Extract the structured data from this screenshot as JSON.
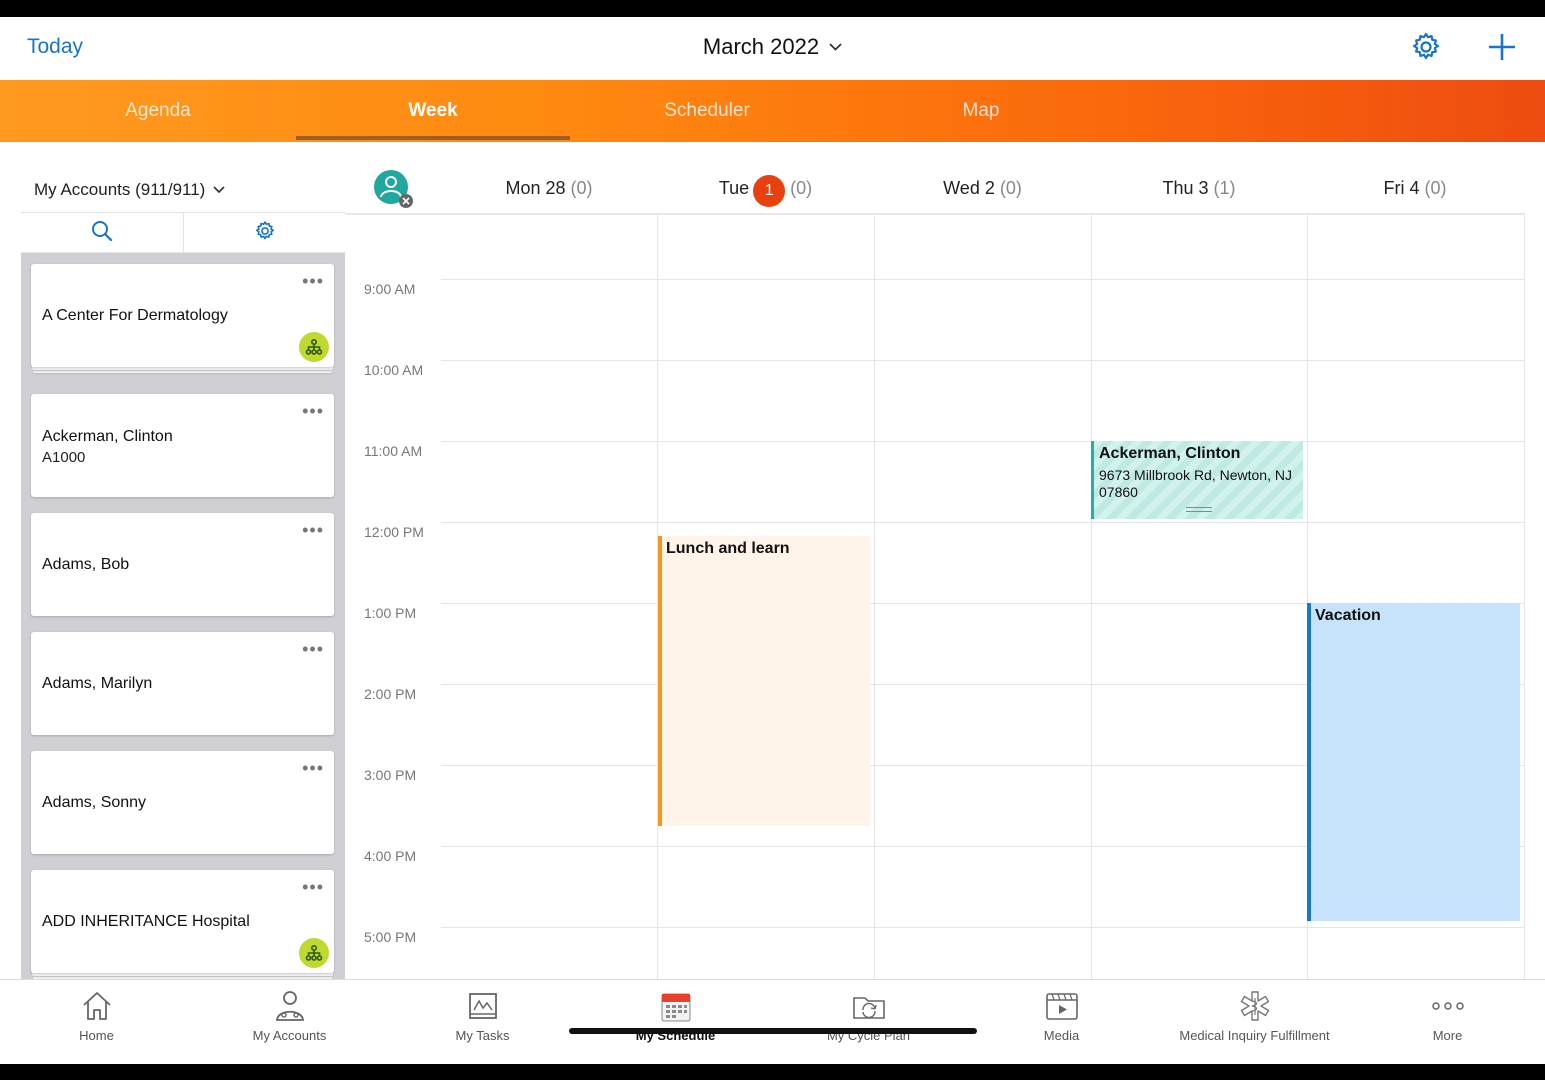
{
  "topbar": {
    "today_label": "Today",
    "month_title": "March 2022"
  },
  "tabs": [
    {
      "label": "Agenda",
      "active": false
    },
    {
      "label": "Week",
      "active": true
    },
    {
      "label": "Scheduler",
      "active": false
    },
    {
      "label": "Map",
      "active": false
    }
  ],
  "accounts": {
    "title": "My Accounts (911/911)",
    "items": [
      {
        "name": "A Center For Dermatology",
        "sub": "",
        "badge": true
      },
      {
        "name": "Ackerman, Clinton",
        "sub": "A1000",
        "badge": false
      },
      {
        "name": "Adams, Bob",
        "sub": "",
        "badge": false
      },
      {
        "name": "Adams, Marilyn",
        "sub": "",
        "badge": false
      },
      {
        "name": "Adams, Sonny",
        "sub": "",
        "badge": false
      },
      {
        "name": "ADD INHERITANCE Hospital",
        "sub": "",
        "badge": true
      }
    ]
  },
  "calendar": {
    "days": [
      {
        "label": "Mon 28",
        "count": "(0)"
      },
      {
        "label": "Tue",
        "today_num": "1",
        "count": "(0)"
      },
      {
        "label": "Wed 2",
        "count": "(0)"
      },
      {
        "label": "Thu 3",
        "count": "(1)"
      },
      {
        "label": "Fri 4",
        "count": "(0)"
      }
    ],
    "times": [
      "9:00 AM",
      "10:00 AM",
      "11:00 AM",
      "12:00 PM",
      "1:00 PM",
      "2:00 PM",
      "3:00 PM",
      "4:00 PM",
      "5:00 PM"
    ],
    "events": [
      {
        "title": "Ackerman, Clinton",
        "sub": "9673 Millbrook Rd, Newton, NJ 07860"
      },
      {
        "title": "Lunch and learn",
        "sub": ""
      },
      {
        "title": "Vacation",
        "sub": ""
      }
    ]
  },
  "bottom_nav": [
    {
      "label": "Home",
      "icon": "home-icon"
    },
    {
      "label": "My Accounts",
      "icon": "accounts-icon"
    },
    {
      "label": "My Tasks",
      "icon": "tasks-icon"
    },
    {
      "label": "My Schedule",
      "icon": "calendar-icon",
      "active": true
    },
    {
      "label": "My Cycle Plan",
      "icon": "cycle-plan-icon"
    },
    {
      "label": "Media",
      "icon": "media-icon"
    },
    {
      "label": "Medical Inquiry Fulfillment",
      "icon": "medical-icon"
    },
    {
      "label": "More",
      "icon": "more-icon"
    }
  ],
  "colors": {
    "accent_blue": "#1a73c9",
    "orange_start": "#ff9a1f",
    "orange_end": "#ee4c10",
    "today_badge": "#e8400e",
    "badge_green": "#c1d82f"
  }
}
